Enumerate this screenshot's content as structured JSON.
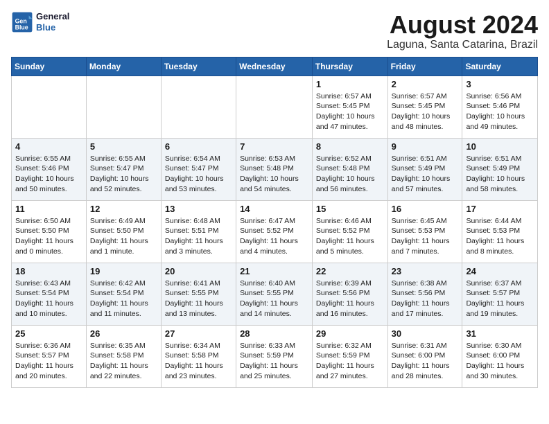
{
  "logo": {
    "line1": "General",
    "line2": "Blue"
  },
  "title": "August 2024",
  "subtitle": "Laguna, Santa Catarina, Brazil",
  "days_header": [
    "Sunday",
    "Monday",
    "Tuesday",
    "Wednesday",
    "Thursday",
    "Friday",
    "Saturday"
  ],
  "weeks": [
    {
      "style": "white",
      "cells": [
        {
          "day": "",
          "info": ""
        },
        {
          "day": "",
          "info": ""
        },
        {
          "day": "",
          "info": ""
        },
        {
          "day": "",
          "info": ""
        },
        {
          "day": "1",
          "info": "Sunrise: 6:57 AM\nSunset: 5:45 PM\nDaylight: 10 hours\nand 47 minutes."
        },
        {
          "day": "2",
          "info": "Sunrise: 6:57 AM\nSunset: 5:45 PM\nDaylight: 10 hours\nand 48 minutes."
        },
        {
          "day": "3",
          "info": "Sunrise: 6:56 AM\nSunset: 5:46 PM\nDaylight: 10 hours\nand 49 minutes."
        }
      ]
    },
    {
      "style": "alt",
      "cells": [
        {
          "day": "4",
          "info": "Sunrise: 6:55 AM\nSunset: 5:46 PM\nDaylight: 10 hours\nand 50 minutes."
        },
        {
          "day": "5",
          "info": "Sunrise: 6:55 AM\nSunset: 5:47 PM\nDaylight: 10 hours\nand 52 minutes."
        },
        {
          "day": "6",
          "info": "Sunrise: 6:54 AM\nSunset: 5:47 PM\nDaylight: 10 hours\nand 53 minutes."
        },
        {
          "day": "7",
          "info": "Sunrise: 6:53 AM\nSunset: 5:48 PM\nDaylight: 10 hours\nand 54 minutes."
        },
        {
          "day": "8",
          "info": "Sunrise: 6:52 AM\nSunset: 5:48 PM\nDaylight: 10 hours\nand 56 minutes."
        },
        {
          "day": "9",
          "info": "Sunrise: 6:51 AM\nSunset: 5:49 PM\nDaylight: 10 hours\nand 57 minutes."
        },
        {
          "day": "10",
          "info": "Sunrise: 6:51 AM\nSunset: 5:49 PM\nDaylight: 10 hours\nand 58 minutes."
        }
      ]
    },
    {
      "style": "white",
      "cells": [
        {
          "day": "11",
          "info": "Sunrise: 6:50 AM\nSunset: 5:50 PM\nDaylight: 11 hours\nand 0 minutes."
        },
        {
          "day": "12",
          "info": "Sunrise: 6:49 AM\nSunset: 5:50 PM\nDaylight: 11 hours\nand 1 minute."
        },
        {
          "day": "13",
          "info": "Sunrise: 6:48 AM\nSunset: 5:51 PM\nDaylight: 11 hours\nand 3 minutes."
        },
        {
          "day": "14",
          "info": "Sunrise: 6:47 AM\nSunset: 5:52 PM\nDaylight: 11 hours\nand 4 minutes."
        },
        {
          "day": "15",
          "info": "Sunrise: 6:46 AM\nSunset: 5:52 PM\nDaylight: 11 hours\nand 5 minutes."
        },
        {
          "day": "16",
          "info": "Sunrise: 6:45 AM\nSunset: 5:53 PM\nDaylight: 11 hours\nand 7 minutes."
        },
        {
          "day": "17",
          "info": "Sunrise: 6:44 AM\nSunset: 5:53 PM\nDaylight: 11 hours\nand 8 minutes."
        }
      ]
    },
    {
      "style": "alt",
      "cells": [
        {
          "day": "18",
          "info": "Sunrise: 6:43 AM\nSunset: 5:54 PM\nDaylight: 11 hours\nand 10 minutes."
        },
        {
          "day": "19",
          "info": "Sunrise: 6:42 AM\nSunset: 5:54 PM\nDaylight: 11 hours\nand 11 minutes."
        },
        {
          "day": "20",
          "info": "Sunrise: 6:41 AM\nSunset: 5:55 PM\nDaylight: 11 hours\nand 13 minutes."
        },
        {
          "day": "21",
          "info": "Sunrise: 6:40 AM\nSunset: 5:55 PM\nDaylight: 11 hours\nand 14 minutes."
        },
        {
          "day": "22",
          "info": "Sunrise: 6:39 AM\nSunset: 5:56 PM\nDaylight: 11 hours\nand 16 minutes."
        },
        {
          "day": "23",
          "info": "Sunrise: 6:38 AM\nSunset: 5:56 PM\nDaylight: 11 hours\nand 17 minutes."
        },
        {
          "day": "24",
          "info": "Sunrise: 6:37 AM\nSunset: 5:57 PM\nDaylight: 11 hours\nand 19 minutes."
        }
      ]
    },
    {
      "style": "white",
      "cells": [
        {
          "day": "25",
          "info": "Sunrise: 6:36 AM\nSunset: 5:57 PM\nDaylight: 11 hours\nand 20 minutes."
        },
        {
          "day": "26",
          "info": "Sunrise: 6:35 AM\nSunset: 5:58 PM\nDaylight: 11 hours\nand 22 minutes."
        },
        {
          "day": "27",
          "info": "Sunrise: 6:34 AM\nSunset: 5:58 PM\nDaylight: 11 hours\nand 23 minutes."
        },
        {
          "day": "28",
          "info": "Sunrise: 6:33 AM\nSunset: 5:59 PM\nDaylight: 11 hours\nand 25 minutes."
        },
        {
          "day": "29",
          "info": "Sunrise: 6:32 AM\nSunset: 5:59 PM\nDaylight: 11 hours\nand 27 minutes."
        },
        {
          "day": "30",
          "info": "Sunrise: 6:31 AM\nSunset: 6:00 PM\nDaylight: 11 hours\nand 28 minutes."
        },
        {
          "day": "31",
          "info": "Sunrise: 6:30 AM\nSunset: 6:00 PM\nDaylight: 11 hours\nand 30 minutes."
        }
      ]
    }
  ]
}
